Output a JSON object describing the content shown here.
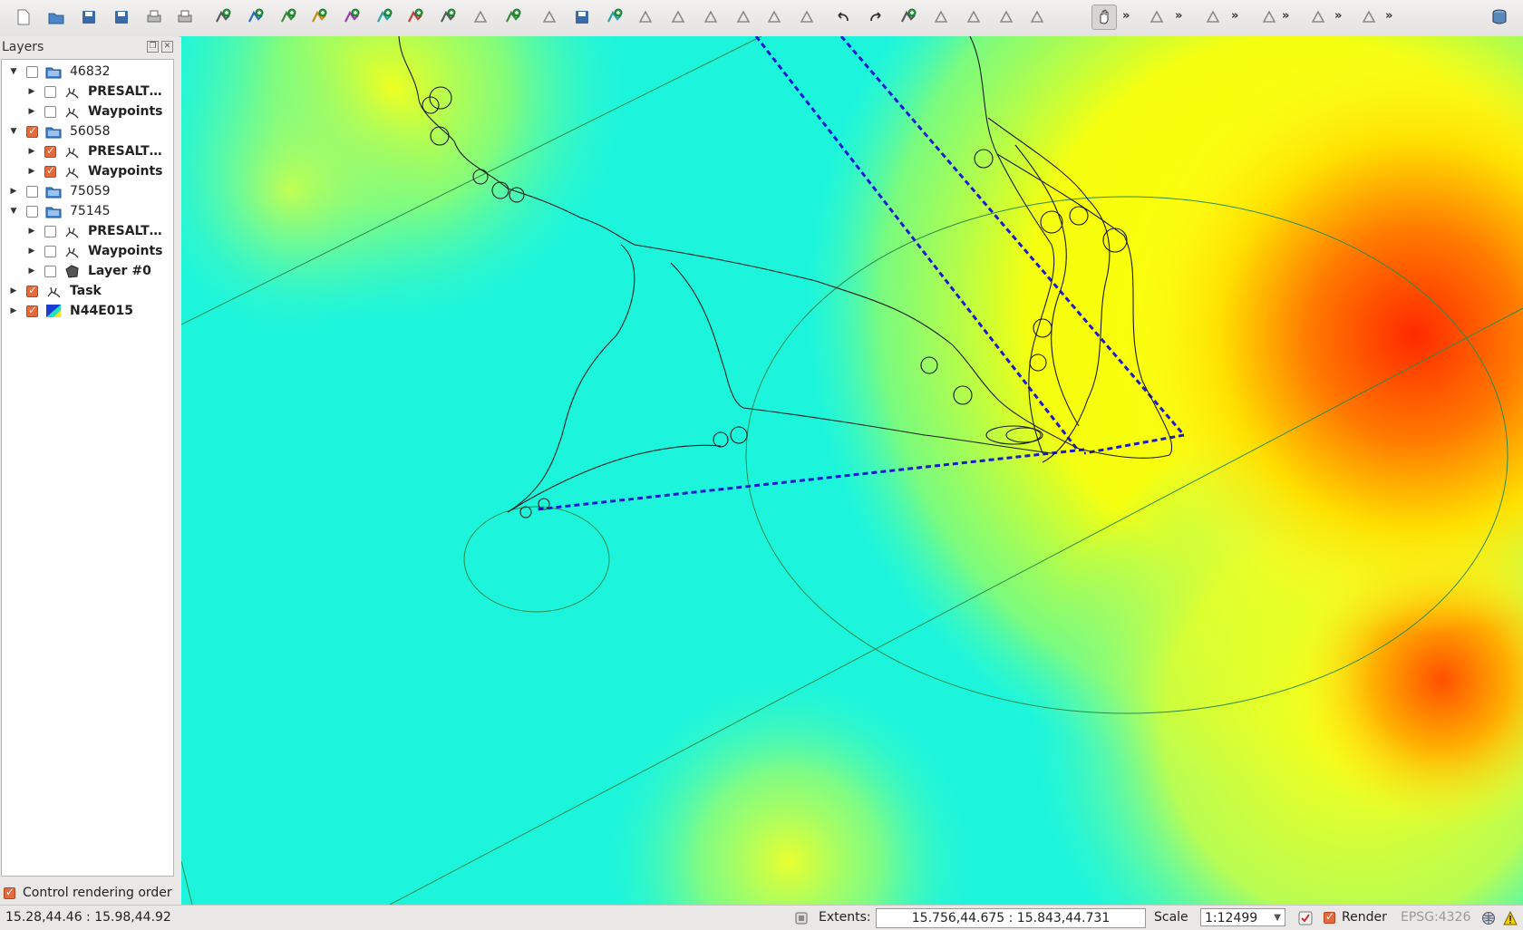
{
  "toolbar": {
    "icons": [
      "new-project-icon",
      "open-project-icon",
      "save-project-icon",
      "save-as-icon",
      "print-composer-icon",
      "print-icon",
      "add-vector-layer-icon",
      "add-raster-layer-icon",
      "add-postgis-layer-icon",
      "add-spatialite-layer-icon",
      "add-mssql-layer-icon",
      "add-wms-layer-icon",
      "add-wcs-layer-icon",
      "add-wfs-layer-icon",
      "remove-layer-icon",
      "add-layer-icon",
      "edit-pencil-icon",
      "save-edits-icon",
      "add-feature-icon",
      "move-feature-icon",
      "node-tool-icon",
      "delete-selected-icon",
      "cut-features-icon",
      "copy-features-icon",
      "paste-features-icon",
      "undo-icon",
      "redo-icon",
      "add-ring-icon",
      "fill-ring-icon",
      "reshape-icon",
      "simplify-icon",
      "delete-ring-icon",
      "pan-icon",
      "identify-icon",
      "select-icon",
      "measure-icon",
      "label-icon",
      "plugin-icon",
      "database-icon"
    ]
  },
  "layers": {
    "title": "Layers",
    "items": [
      {
        "name": "46832",
        "level": 0,
        "checked": false,
        "expanded": true,
        "bold": false,
        "icon": "group-folder-icon"
      },
      {
        "name": "PRESALT…",
        "level": 1,
        "checked": false,
        "expanded": false,
        "bold": true,
        "icon": "line-layer-icon"
      },
      {
        "name": "Waypoints",
        "level": 1,
        "checked": false,
        "expanded": false,
        "bold": true,
        "icon": "line-layer-icon"
      },
      {
        "name": "56058",
        "level": 0,
        "checked": true,
        "expanded": true,
        "bold": false,
        "icon": "group-folder-icon"
      },
      {
        "name": "PRESALT…",
        "level": 1,
        "checked": true,
        "expanded": false,
        "bold": true,
        "icon": "line-layer-icon"
      },
      {
        "name": "Waypoints",
        "level": 1,
        "checked": true,
        "expanded": false,
        "bold": true,
        "icon": "line-layer-icon"
      },
      {
        "name": "75059",
        "level": 0,
        "checked": false,
        "expanded": false,
        "bold": false,
        "icon": "group-folder-icon"
      },
      {
        "name": "75145",
        "level": 0,
        "checked": false,
        "expanded": true,
        "bold": false,
        "icon": "group-folder-icon"
      },
      {
        "name": "PRESALT…",
        "level": 1,
        "checked": false,
        "expanded": false,
        "bold": true,
        "icon": "line-layer-icon"
      },
      {
        "name": "Waypoints",
        "level": 1,
        "checked": false,
        "expanded": false,
        "bold": true,
        "icon": "line-layer-icon"
      },
      {
        "name": "Layer #0",
        "level": 1,
        "checked": false,
        "expanded": false,
        "bold": true,
        "icon": "polygon-layer-icon"
      },
      {
        "name": "Task",
        "level": 0,
        "checked": true,
        "expanded": false,
        "bold": true,
        "icon": "line-layer-icon"
      },
      {
        "name": "N44E015",
        "level": 0,
        "checked": true,
        "expanded": false,
        "bold": true,
        "icon": "raster-layer-icon"
      }
    ],
    "control_rendering_order": "Control rendering order",
    "control_rendering_order_checked": true
  },
  "status": {
    "coordinates": "15.28,44.46 : 15.98,44.92",
    "extents_label": "Extents:",
    "extents_value": "15.756,44.675 : 15.843,44.731",
    "scale_label": "Scale",
    "scale_value": "1:12499",
    "render_label": "Render",
    "render_checked": true,
    "crs": "EPSG:4326"
  },
  "colors": {
    "low": "#1cf5dc",
    "mid": "#ffff1c",
    "high": "#ff3a00",
    "task_line": "#1a1ad0",
    "track": "#1c1c1c",
    "cylinder": "#2d8a4a"
  }
}
